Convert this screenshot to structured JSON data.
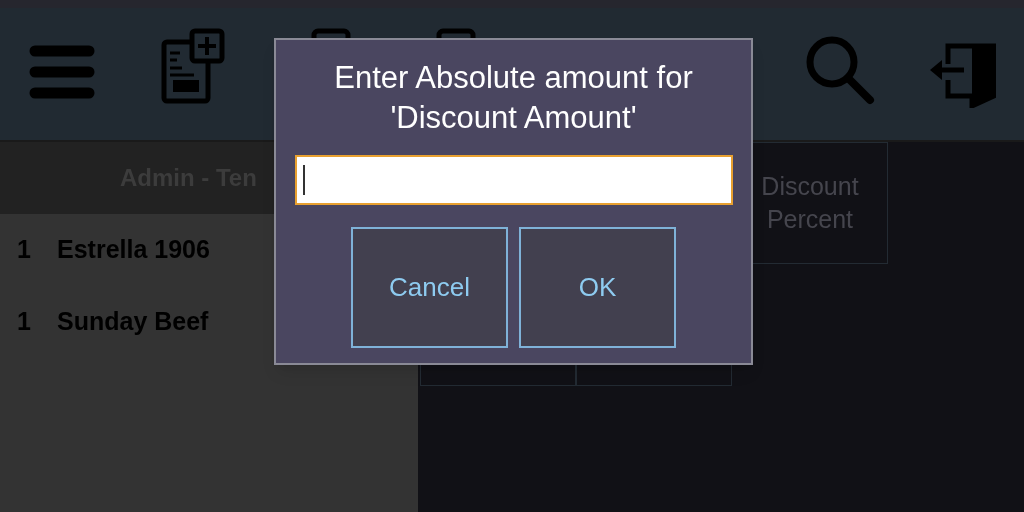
{
  "toolbar": {
    "items": [
      {
        "kind": "menu"
      },
      {
        "kind": "new-tab"
      },
      {
        "kind": "hidden"
      },
      {
        "kind": "hidden"
      },
      {
        "kind": "search"
      },
      {
        "kind": "exit"
      }
    ]
  },
  "order": {
    "header": "Admin - Ten",
    "items": [
      {
        "qty": "1",
        "name": "Estrella 1906"
      },
      {
        "qty": "1",
        "name": "Sunday Beef"
      }
    ]
  },
  "actions": {
    "rows": [
      [
        {
          "kind": "covered"
        },
        {
          "kind": "covered"
        },
        {
          "kind": "button",
          "label": "Discount Percent"
        }
      ],
      [
        {
          "kind": "button"
        },
        {
          "kind": "button"
        }
      ]
    ]
  },
  "dialog": {
    "title": "Enter Absolute amount for 'Discount Amount'",
    "buttons": [
      "Cancel",
      "OK"
    ]
  }
}
